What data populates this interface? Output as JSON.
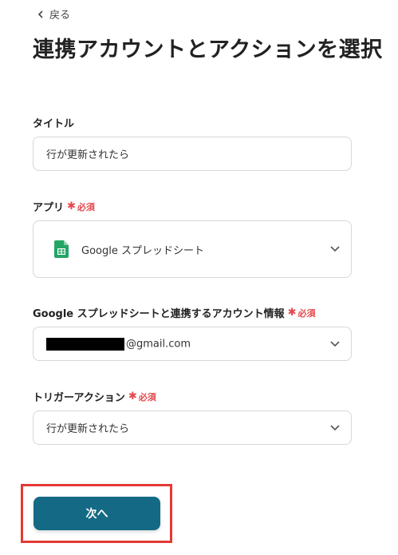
{
  "header": {
    "back_label": "戻る",
    "title": "連携アカウントとアクションを選択"
  },
  "form": {
    "required_label": "必須",
    "title_field": {
      "label": "タイトル",
      "value": "行が更新されたら"
    },
    "app_field": {
      "label": "アプリ",
      "value": "Google スプレッドシート",
      "icon": "google-sheets-icon"
    },
    "account_field": {
      "label": "Google スプレッドシートと連携するアカウント情報",
      "value_suffix": "@gmail.com"
    },
    "trigger_field": {
      "label": "トリガーアクション",
      "value": "行が更新されたら"
    }
  },
  "footer": {
    "next_label": "次へ"
  },
  "colors": {
    "primary": "#146a85",
    "required": "#e5484d",
    "highlight_border": "#e53935",
    "sheets_green": "#23a566"
  }
}
